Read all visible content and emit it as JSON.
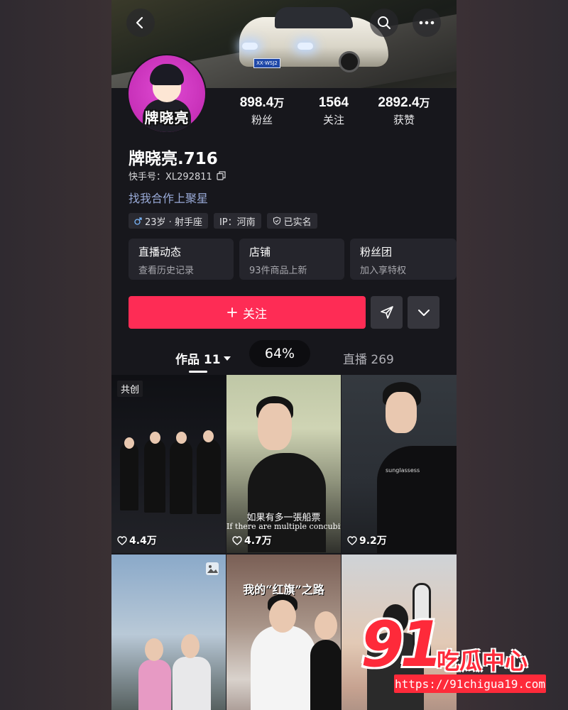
{
  "header": {
    "car_plate": "XX·WSJ2"
  },
  "profile": {
    "avatar_text": "牌晓亮",
    "name": "牌晓亮.716",
    "uid_label": "快手号：XL292811",
    "bio": "找我合作上聚星",
    "tags": {
      "age": "23岁 · 射手座",
      "ip": "IP：河南",
      "verified": "已实名"
    }
  },
  "stats": {
    "fans": {
      "value": "898.4",
      "unit": "万",
      "label": "粉丝"
    },
    "following": {
      "value": "1564",
      "label": "关注"
    },
    "likes": {
      "value": "2892.4",
      "unit": "万",
      "label": "获赞"
    }
  },
  "cards": [
    {
      "title": "直播动态",
      "subtitle": "查看历史记录"
    },
    {
      "title": "店铺",
      "subtitle": "93件商品上新"
    },
    {
      "title": "粉丝团",
      "subtitle": "加入享特权"
    }
  ],
  "actions": {
    "follow_label": "关注"
  },
  "tabs": {
    "works": "作品 11",
    "live": "直播 269",
    "zoom": "64%"
  },
  "grid": [
    {
      "likes": "4.4万",
      "badge": "共创"
    },
    {
      "likes": "4.7万",
      "caption_cn": "如果有多一張船票",
      "caption_en": "If there are multiple concubine"
    },
    {
      "likes": "9.2万",
      "caption_en": "sunglassess"
    },
    {
      "likes": ""
    },
    {
      "likes": "",
      "caption_cn": "我的“红旗”之路"
    },
    {
      "likes": ""
    }
  ],
  "watermark": {
    "number": "91",
    "text": "吃瓜中心",
    "url": "https://91chigua19.com"
  },
  "colors": {
    "accent": "#fe2c55",
    "background": "#17171c",
    "bio": "#98a9d6"
  }
}
